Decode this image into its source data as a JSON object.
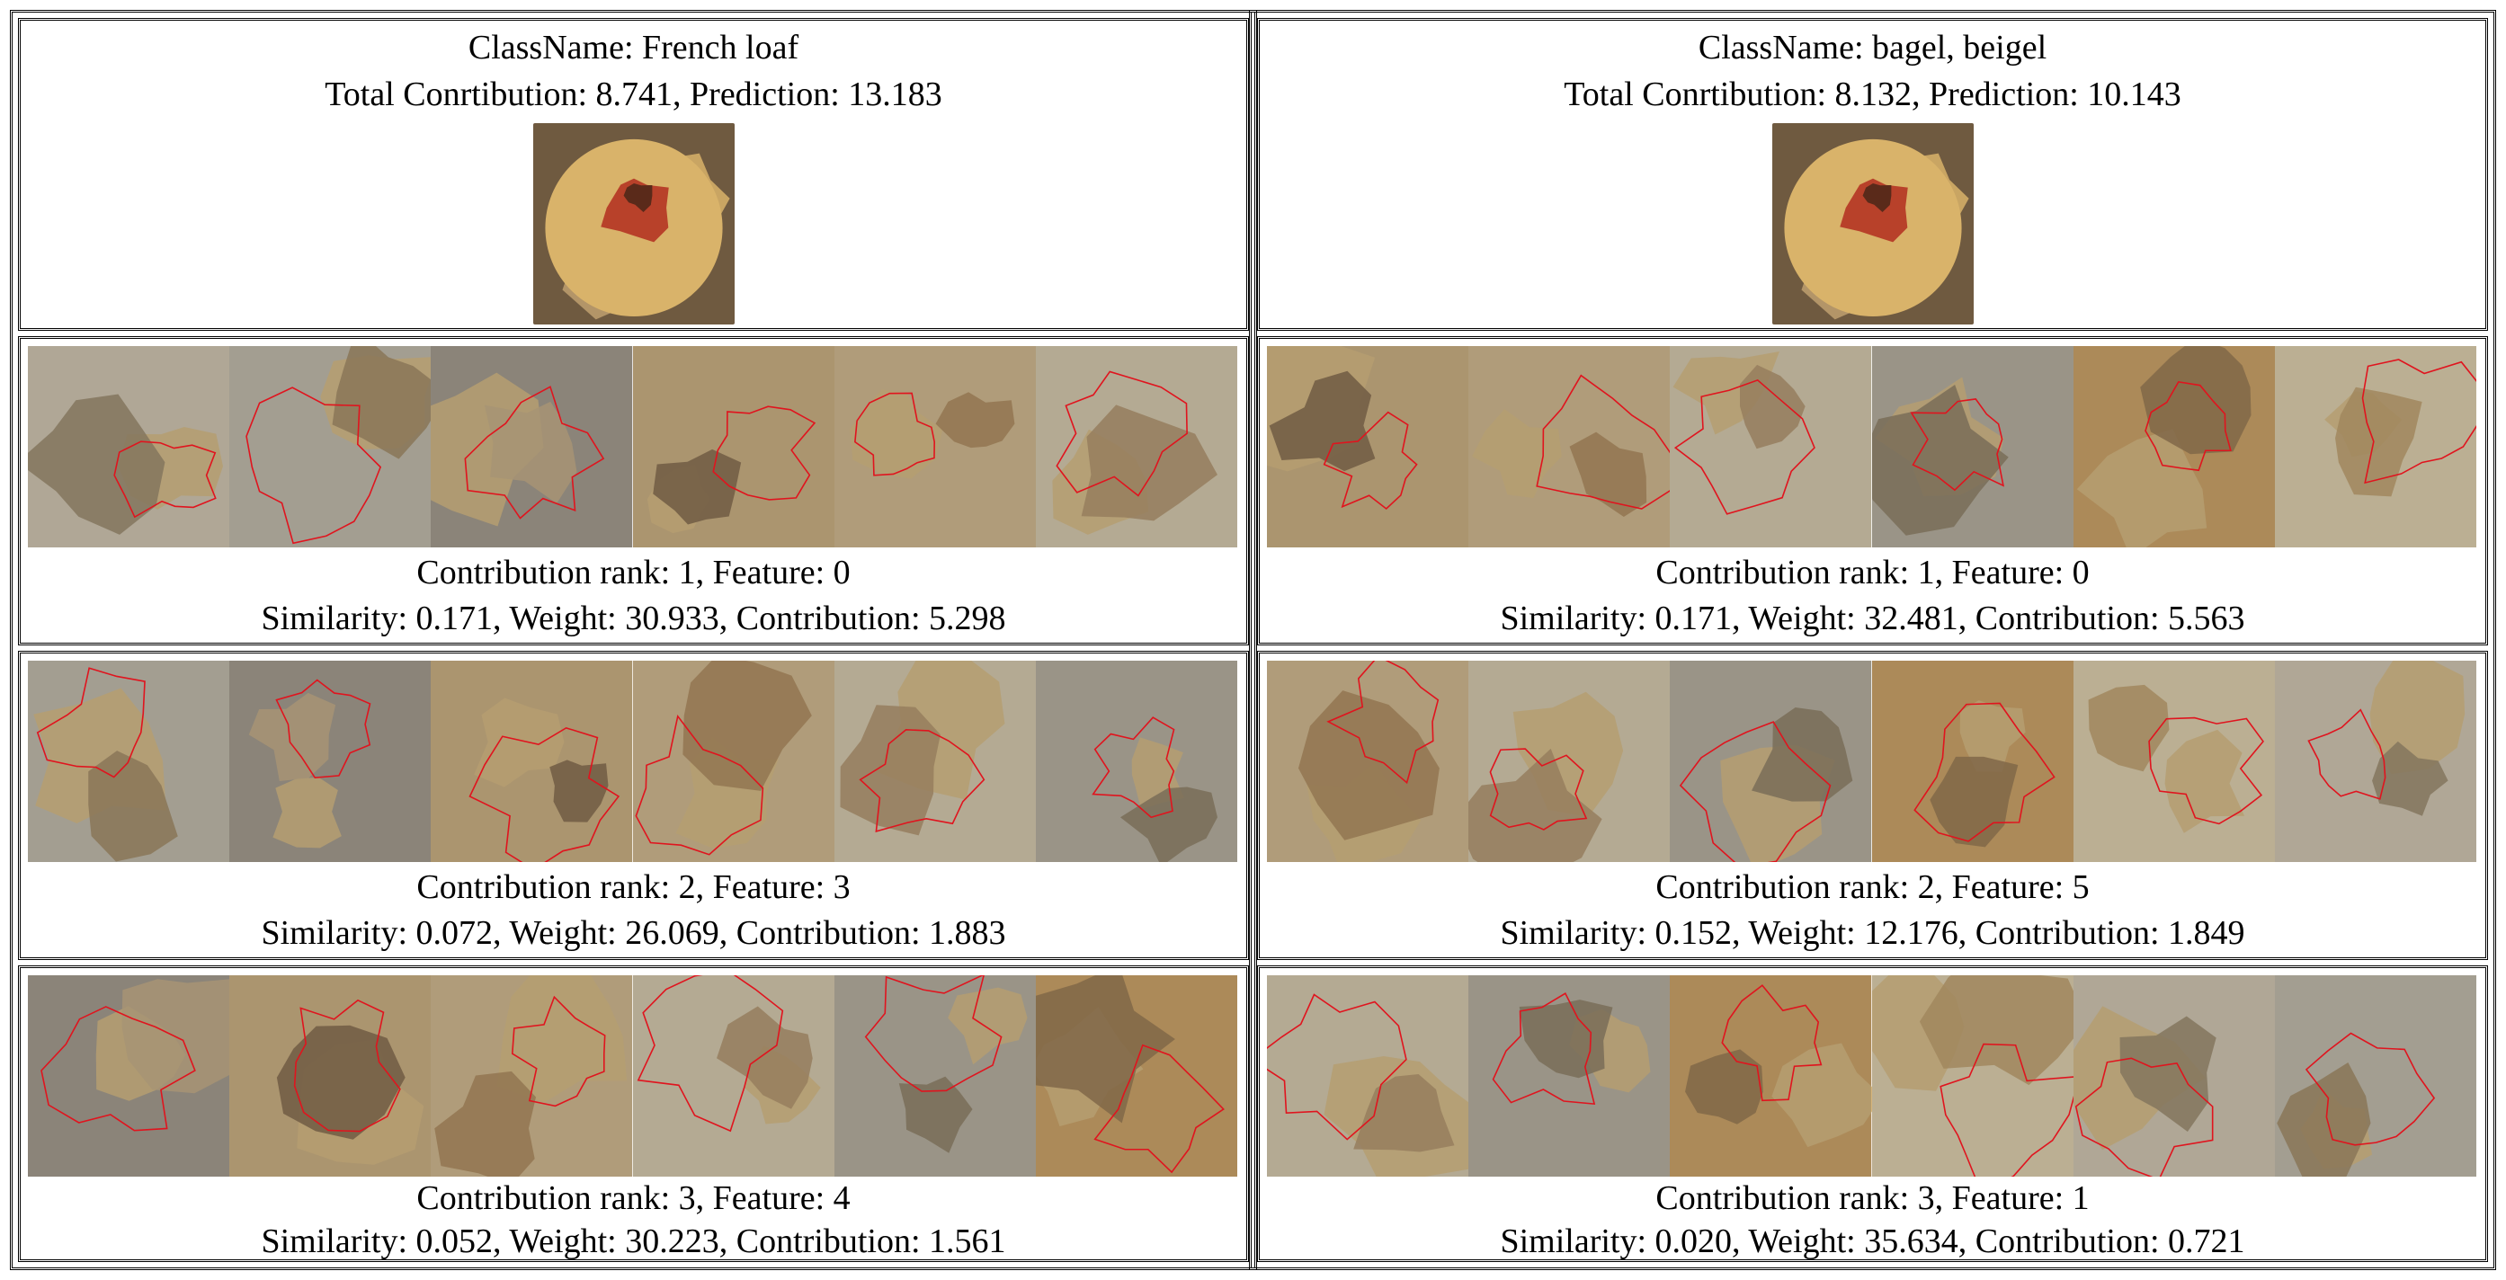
{
  "panels": [
    {
      "classname": "ClassName: French loaf",
      "totals": "Total Conrtibution: 8.741, Prediction: 13.183",
      "rows": [
        {
          "rank_line": "Contribution rank: 1, Feature: 0",
          "stats_line": "Similarity: 0.171, Weight: 30.933, Contribution: 5.298"
        },
        {
          "rank_line": "Contribution rank: 2, Feature: 3",
          "stats_line": "Similarity: 0.072, Weight: 26.069, Contribution: 1.883"
        },
        {
          "rank_line": "Contribution rank: 3, Feature: 4",
          "stats_line": "Similarity: 0.052, Weight: 30.223, Contribution: 1.561"
        }
      ]
    },
    {
      "classname": "ClassName: bagel, beigel",
      "totals": "Total Conrtibution: 8.132, Prediction: 10.143",
      "rows": [
        {
          "rank_line": "Contribution rank: 1, Feature: 0",
          "stats_line": "Similarity: 0.171, Weight: 32.481, Contribution: 5.563"
        },
        {
          "rank_line": "Contribution rank: 2, Feature: 5",
          "stats_line": "Similarity: 0.152, Weight: 12.176, Contribution: 1.849"
        },
        {
          "rank_line": "Contribution rank: 3, Feature: 1",
          "stats_line": "Similarity: 0.020, Weight: 35.634, Contribution: 0.721"
        }
      ]
    }
  ],
  "colors": {
    "outline": "#e0141e",
    "dim_overlay": "#8a8579",
    "bread_light": "#d9b36a",
    "bread_dark": "#9a6a2c",
    "sauce": "#b8412a"
  }
}
